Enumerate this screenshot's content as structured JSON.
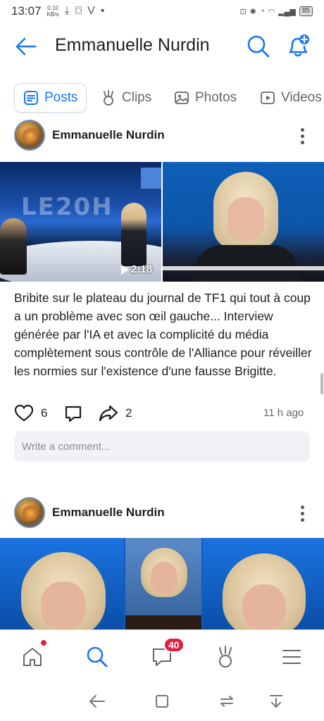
{
  "status_bar": {
    "time": "13:07",
    "net_speed_value": "0.10",
    "net_speed_unit": "KB/s",
    "battery": "85"
  },
  "header": {
    "title": "Emmanuelle Nurdin"
  },
  "tabs": [
    {
      "label": "Posts",
      "active": true
    },
    {
      "label": "Clips",
      "active": false
    },
    {
      "label": "Photos",
      "active": false
    },
    {
      "label": "Videos",
      "active": false
    }
  ],
  "posts": [
    {
      "author": "Emmanuelle Nurdin",
      "video_duration": "2:18",
      "caption": "Bribite sur le plateau du journal de TF1 qui tout à coup a un problème avec son œil gauche... Interview générée par l'IA et avec la complicité du média complètement sous contrôle de l'Alliance pour réveiller les normies sur l'existence d'une fausse Brigitte.",
      "likes": "6",
      "shares": "2",
      "time_ago": "11 h ago",
      "comment_placeholder": "Write a comment..."
    },
    {
      "author": "Emmanuelle Nurdin"
    }
  ],
  "bottom_nav": {
    "messages_badge": "40"
  },
  "colors": {
    "accent": "#1877f2",
    "badge": "#e41e3f"
  }
}
